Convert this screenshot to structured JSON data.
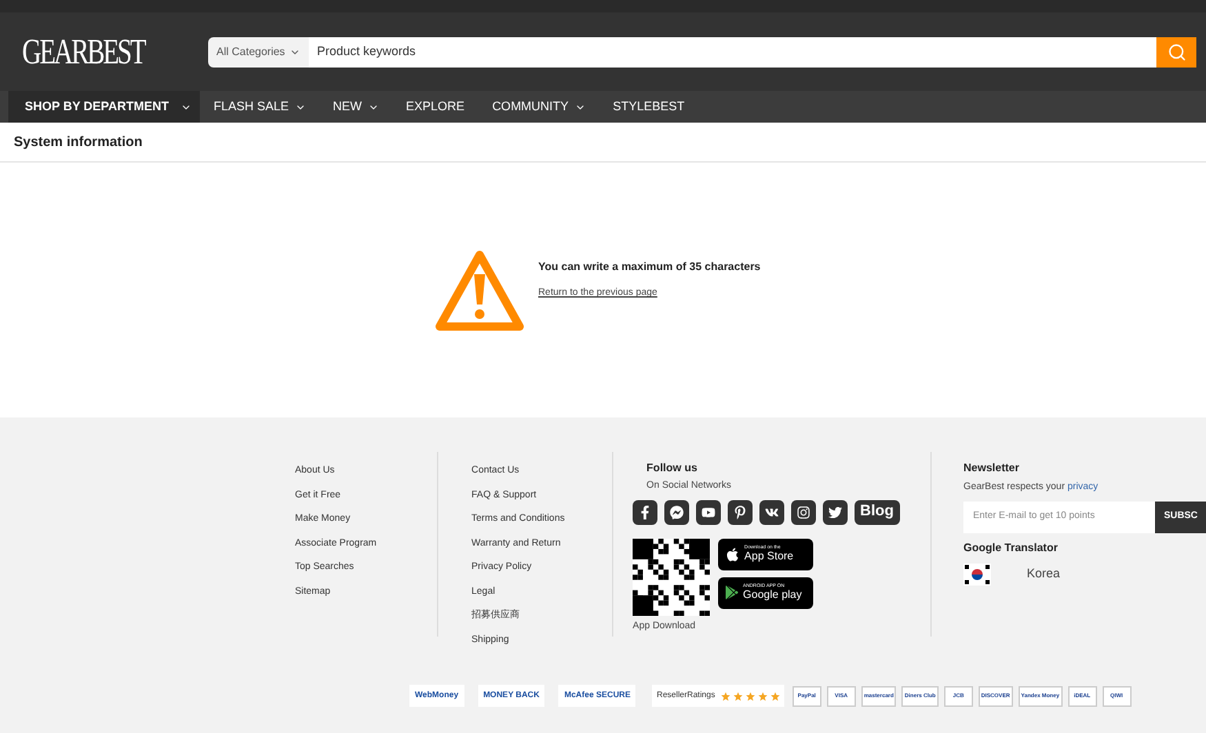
{
  "header": {
    "logo": "GEARBEST",
    "search": {
      "category": "All Categories",
      "placeholder": "Product keywords"
    }
  },
  "nav": [
    {
      "label": "SHOP BY DEPARTMENT",
      "dropdown": true,
      "selected": true
    },
    {
      "label": "FLASH SALE",
      "dropdown": true,
      "selected": false
    },
    {
      "label": "NEW",
      "dropdown": true,
      "selected": false
    },
    {
      "label": "EXPLORE",
      "dropdown": false,
      "selected": false
    },
    {
      "label": "COMMUNITY",
      "dropdown": true,
      "selected": false
    },
    {
      "label": "STYLEBEST",
      "dropdown": false,
      "selected": false
    }
  ],
  "page_title": "System information",
  "message": {
    "text": "You can write a maximum of 35 characters",
    "link": "Return to the previous page"
  },
  "footer": {
    "links_1": [
      "About Us",
      "Get it Free",
      "Make Money",
      "Associate Program",
      "Top Searches",
      "Sitemap"
    ],
    "links_2": [
      "Contact Us",
      "FAQ & Support",
      "Terms and Conditions",
      "Warranty and Return",
      "Privacy Policy",
      "Legal",
      "招募供应商",
      "Shipping"
    ],
    "follow": {
      "title": "Follow us",
      "subtitle": "On Social Networks",
      "social": [
        {
          "kind": "facebook"
        },
        {
          "kind": "messenger"
        },
        {
          "kind": "youtube"
        },
        {
          "kind": "pinterest"
        },
        {
          "kind": "vk"
        },
        {
          "kind": "instagram"
        },
        {
          "kind": "twitter"
        },
        {
          "kind": "blog",
          "label": "Blog"
        }
      ],
      "stores": [
        {
          "kind": "apple",
          "small": "Download on the",
          "label": "App Store"
        },
        {
          "kind": "google",
          "small": "ANDROID APP ON",
          "label": "Google play"
        }
      ],
      "app_download": "App Download"
    },
    "newsletter": {
      "title": "Newsletter",
      "text": "GearBest respects your",
      "link": "privacy",
      "placeholder": "Enter E-mail to get 10 points",
      "button": "SUBSC"
    },
    "translator": {
      "title": "Google Translator",
      "language": "Korea"
    },
    "badges": [
      {
        "label": "WebMoney",
        "kind": "security"
      },
      {
        "label": "MONEY BACK",
        "kind": "security"
      },
      {
        "label": "McAfee SECURE",
        "kind": "security"
      },
      {
        "label": "ResellerRatings",
        "kind": "rating",
        "stars": 5
      },
      {
        "label": "PayPal",
        "kind": "payment"
      },
      {
        "label": "VISA",
        "kind": "payment"
      },
      {
        "label": "mastercard",
        "kind": "payment"
      },
      {
        "label": "Diners Club",
        "kind": "payment"
      },
      {
        "label": "JCB",
        "kind": "payment"
      },
      {
        "label": "DISCOVER",
        "kind": "payment"
      },
      {
        "label": "Yandex Money",
        "kind": "payment"
      },
      {
        "label": "iDEAL",
        "kind": "payment"
      },
      {
        "label": "QIWI",
        "kind": "payment"
      }
    ]
  }
}
